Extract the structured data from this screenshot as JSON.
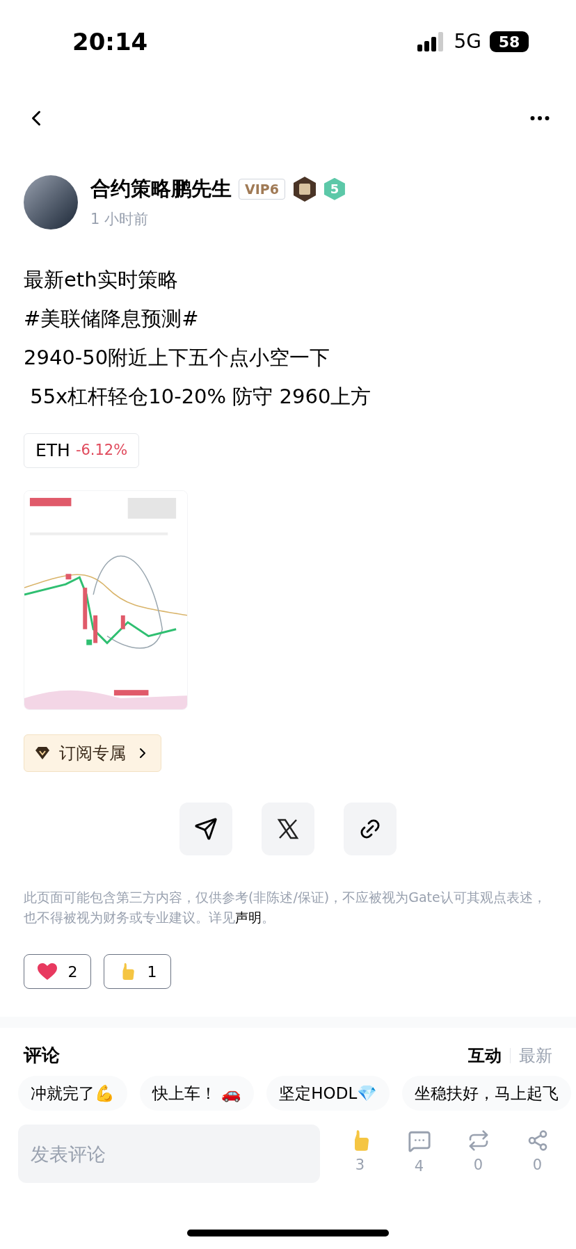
{
  "status_bar": {
    "time": "20:14",
    "network": "5G",
    "battery": "58"
  },
  "author": {
    "name": "合约策略鹏先生",
    "vip": "VIP6",
    "level": "5",
    "time": "1 小时前"
  },
  "post": {
    "lines": [
      "最新eth实时策略",
      "#美联储降息预测#",
      "2940-50附近上下五个点小空一下",
      " 55x杠杆轻仓10-20% 防守 2960上方"
    ],
    "ticker": {
      "symbol": "ETH",
      "change": "-6.12%"
    },
    "subscribe": "订阅专属"
  },
  "disclaimer": {
    "text": "此页面可能包含第三方内容，仅供参考(非陈述/保证)，不应被视为Gate认可其观点表述，也不得被视为财务或专业建议。详见",
    "link": "声明",
    "end": "。"
  },
  "reactions": [
    {
      "kind": "heart",
      "count": "2"
    },
    {
      "kind": "thumb",
      "count": "1"
    }
  ],
  "comments": {
    "title": "评论",
    "sort": [
      {
        "label": "互动",
        "selected": true
      },
      {
        "label": "最新",
        "selected": false
      }
    ]
  },
  "quick_replies": [
    "冲就完了💪",
    "快上车！ 🚗",
    "坚定HODL💎",
    "坐稳扶好，马上起飞"
  ],
  "bottom_bar": {
    "placeholder": "发表评论",
    "actions": [
      {
        "kind": "like",
        "count": "3"
      },
      {
        "kind": "comment",
        "count": "4"
      },
      {
        "kind": "repost",
        "count": "0"
      },
      {
        "kind": "share",
        "count": "0"
      }
    ]
  }
}
